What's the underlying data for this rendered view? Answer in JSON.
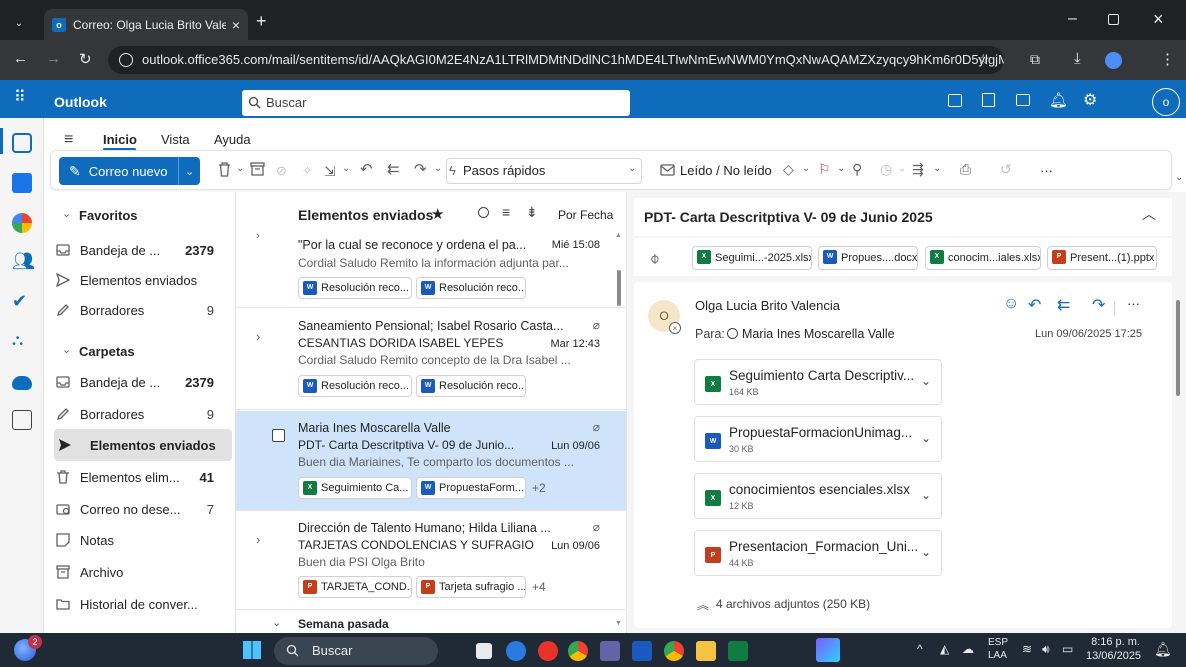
{
  "browser": {
    "tab_title": "Correo: Olga Lucia Brito Valenc",
    "favicon_text": "o",
    "url": "outlook.office365.com/mail/sentitems/id/AAQkAGI0M2E4NzA1LTRlMDMtNDdlNC1hMDE4LTIwNmEwNWM0YmQxNwAQAMZXzyqcy9hKm6r0D5ylgjM%3D"
  },
  "outlook": {
    "app_name": "Outlook",
    "search_placeholder": "Buscar"
  },
  "ribbon": {
    "tabs": [
      "Inicio",
      "Vista",
      "Ayuda"
    ],
    "new_mail": "Correo nuevo",
    "quick_steps": "Pasos rápidos",
    "read_unread": "Leído / No leído",
    "more": "···"
  },
  "folders": {
    "favorites_label": "Favoritos",
    "favorites": [
      {
        "label": "Bandeja de ...",
        "count": "2379"
      },
      {
        "label": "Elementos enviados",
        "count": ""
      },
      {
        "label": "Borradores",
        "count": "9"
      }
    ],
    "folders_label": "Carpetas",
    "items": [
      {
        "label": "Bandeja de ...",
        "count": "2379"
      },
      {
        "label": "Borradores",
        "count": "9"
      },
      {
        "label": "Elementos enviados",
        "count": ""
      },
      {
        "label": "Elementos elim...",
        "count": "41"
      },
      {
        "label": "Correo no dese...",
        "count": "7"
      },
      {
        "label": "Notas",
        "count": ""
      },
      {
        "label": "Archivo",
        "count": ""
      },
      {
        "label": "Historial de conver...",
        "count": ""
      }
    ]
  },
  "list": {
    "title": "Elementos enviados",
    "sort_label": "Por Fecha",
    "messages": [
      {
        "from": "",
        "subject": "\"Por la cual se reconoce y ordena el pa...",
        "date": "Mié 15:08",
        "preview": "Cordial Saludo Remito la información adjunta par...",
        "chips": [
          "Resolución reco...",
          "Resolución reco..."
        ],
        "more": ""
      },
      {
        "from": "Saneamiento Pensional; Isabel Rosario Casta...",
        "subject": "CESANTIAS DORIDA ISABEL YEPES",
        "date": "Mar 12:43",
        "preview": "Cordial Saludo Remito concepto de la Dra Isabel ...",
        "chips": [
          "Resolución reco...",
          "Resolución reco..."
        ],
        "more": ""
      },
      {
        "from": "Maria Ines Moscarella Valle",
        "subject": "PDT- Carta Descritptiva V- 09 de Junio...",
        "date": "Lun 09/06",
        "preview": "Buen dia Mariaines, Te comparto los documentos ...",
        "chips": [
          "Seguimiento Ca...",
          "PropuestaForm..."
        ],
        "more": "+2"
      },
      {
        "from": "Dirección de Talento Humano; Hilda Liliana ...",
        "subject": "TARJETAS CONDOLENCIAS Y SUFRAGIO",
        "date": "Lun 09/06",
        "preview": "Buen dia PSI Olga Brito",
        "chips": [
          "TARJETA_COND...",
          "Tarjeta sufragio ..."
        ],
        "more": "+4"
      }
    ],
    "group_header": "Semana pasada"
  },
  "reading": {
    "subject": "PDT- Carta Descritptiva V- 09 de Junio 2025",
    "top_attachments": [
      "Seguimi...-2025.xlsx",
      "Propues....docx",
      "conocim...iales.xlsx",
      "Present...(1).pptx"
    ],
    "avatar_initial": "O",
    "sender": "Olga Lucia Brito Valencia",
    "to_label": "Para:",
    "recipient": "Maria Ines Moscarella Valle",
    "datetime": "Lun 09/06/2025 17:25",
    "attachments": [
      {
        "name": "Seguimiento Carta Descriptiv...",
        "size": "164 KB",
        "type": "xls"
      },
      {
        "name": "PropuestaFormacionUnimag...",
        "size": "30 KB",
        "type": "doc"
      },
      {
        "name": "conocimientos esenciales.xlsx",
        "size": "12 KB",
        "type": "xls"
      },
      {
        "name": "Presentacion_Formacion_Uni...",
        "size": "44 KB",
        "type": "ppt"
      }
    ],
    "attachments_summary": "4 archivos adjuntos (250 KB)"
  },
  "taskbar": {
    "search": "Buscar",
    "lang": "ESP",
    "lang_sub": "LAA",
    "time": "8:16 p. m.",
    "date": "13/06/2025",
    "notif_badge": "2"
  },
  "colors": {
    "accent": "#0f6cbd",
    "selected_row": "#cfe4fa"
  }
}
